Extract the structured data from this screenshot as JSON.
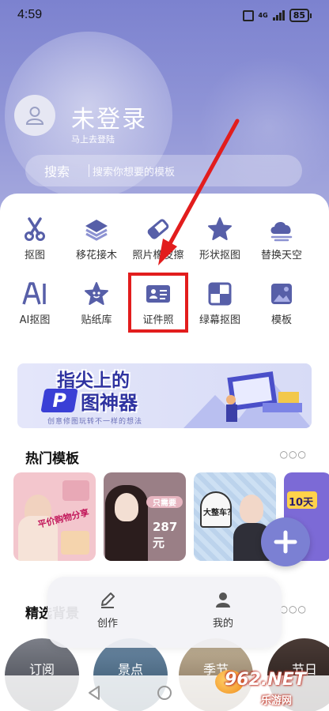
{
  "status": {
    "time": "4:59",
    "network": "4G",
    "battery": "85"
  },
  "user": {
    "title": "未登录",
    "subtitle": "马上去登陆"
  },
  "search": {
    "label": "搜索",
    "placeholder": "搜索你想要的模板"
  },
  "tools": [
    {
      "label": "抠图",
      "icon": "scissors-icon"
    },
    {
      "label": "移花接木",
      "icon": "layers-icon"
    },
    {
      "label": "照片橡皮擦",
      "icon": "eraser-icon"
    },
    {
      "label": "形状抠图",
      "icon": "star-icon"
    },
    {
      "label": "替换天空",
      "icon": "cloud-icon"
    },
    {
      "label": "AI抠图",
      "icon": "ai-icon"
    },
    {
      "label": "贴纸库",
      "icon": "sticker-icon"
    },
    {
      "label": "证件照",
      "icon": "id-card-icon"
    },
    {
      "label": "绿幕抠图",
      "icon": "green-screen-icon"
    },
    {
      "label": "模板",
      "icon": "template-icon"
    }
  ],
  "banner": {
    "line1": "指尖上的",
    "p": "P",
    "line2": "图神器",
    "sub": "创意修图玩转不一样的想法"
  },
  "hot_templates": {
    "title": "热门模板",
    "items": [
      {
        "text": "平价购物分享"
      },
      {
        "text": "287元",
        "tag": "只需要"
      },
      {
        "text": "大整车？"
      },
      {
        "text": "10天"
      }
    ]
  },
  "featured_bg": {
    "title": "精选背景",
    "items": [
      "订阅",
      "景点",
      "季节",
      "节日"
    ]
  },
  "tabbar": {
    "create": "创作",
    "mine": "我的"
  },
  "watermark": {
    "text": "962.NET",
    "sub": "乐游网"
  },
  "colors": {
    "accent": "#7b80d3",
    "icon": "#575fa8",
    "highlight": "#e21d1d"
  }
}
